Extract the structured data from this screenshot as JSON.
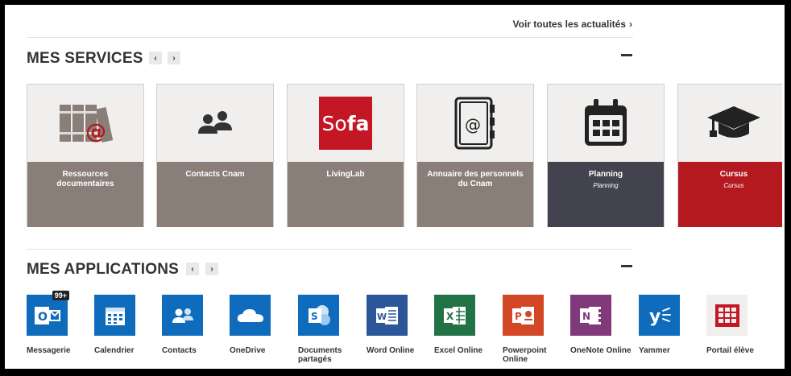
{
  "news": {
    "see_all": "Voir toutes les actualités",
    "chevron": "›"
  },
  "services": {
    "title": "MES SERVICES",
    "prev": "‹",
    "next": "›",
    "tiles": [
      {
        "label": "Ressources documentaires",
        "sub": "",
        "color": "#8a7f78",
        "icon": "books-at-icon"
      },
      {
        "label": "Contacts Cnam",
        "sub": "",
        "color": "#8a7f78",
        "icon": "people-icon"
      },
      {
        "label": "LivingLab",
        "sub": "",
        "color": "#8a7f78",
        "icon": "sofa-logo",
        "logo_text_1": "So",
        "logo_text_2": "fa"
      },
      {
        "label": "Annuaire des personnels du Cnam",
        "sub": "",
        "color": "#8a7f78",
        "icon": "address-book-icon"
      },
      {
        "label": "Planning",
        "sub": "Planning",
        "color": "#43434f",
        "icon": "calendar-icon"
      },
      {
        "label": "Cursus",
        "sub": "Cursus",
        "color": "#b3191f",
        "icon": "graduation-cap-icon"
      }
    ]
  },
  "applications": {
    "title": "MES APPLICATIONS",
    "prev": "‹",
    "next": "›",
    "items": [
      {
        "label": "Messagerie",
        "color": "#0f6cbd",
        "icon": "outlook-icon",
        "badge": "99+",
        "glyph": "O"
      },
      {
        "label": "Calendrier",
        "color": "#0f6cbd",
        "icon": "calendar-app-icon",
        "glyph": "▦"
      },
      {
        "label": "Contacts",
        "color": "#0f6cbd",
        "icon": "contacts-icon",
        "glyph": "👥"
      },
      {
        "label": "OneDrive",
        "color": "#0f6cbd",
        "icon": "onedrive-icon",
        "glyph": "☁"
      },
      {
        "label": "Documents partagés",
        "color": "#0f6cbd",
        "icon": "sharepoint-icon",
        "glyph": "S"
      },
      {
        "label": "Word Online",
        "color": "#2b579a",
        "icon": "word-icon",
        "glyph": "W"
      },
      {
        "label": "Excel Online",
        "color": "#217346",
        "icon": "excel-icon",
        "glyph": "X"
      },
      {
        "label": "Powerpoint Online",
        "color": "#d24726",
        "icon": "powerpoint-icon",
        "glyph": "P"
      },
      {
        "label": "OneNote Online",
        "color": "#80397b",
        "icon": "onenote-icon",
        "glyph": "N"
      },
      {
        "label": "Yammer",
        "color": "#0f6cbd",
        "icon": "yammer-icon",
        "glyph": "y"
      },
      {
        "label": "Portail élève",
        "color": "#f0efed",
        "icon": "grid-icon",
        "glyph": "▦"
      }
    ]
  }
}
